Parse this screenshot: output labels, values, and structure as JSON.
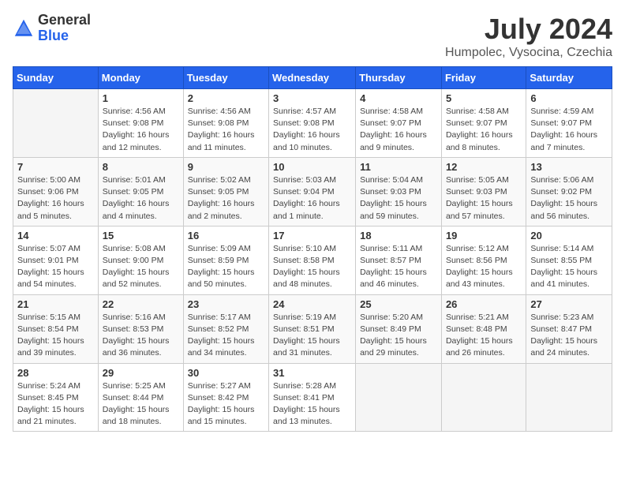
{
  "header": {
    "logo_general": "General",
    "logo_blue": "Blue",
    "month": "July 2024",
    "location": "Humpolec, Vysocina, Czechia"
  },
  "weekdays": [
    "Sunday",
    "Monday",
    "Tuesday",
    "Wednesday",
    "Thursday",
    "Friday",
    "Saturday"
  ],
  "weeks": [
    [
      {
        "day": "",
        "info": ""
      },
      {
        "day": "1",
        "info": "Sunrise: 4:56 AM\nSunset: 9:08 PM\nDaylight: 16 hours\nand 12 minutes."
      },
      {
        "day": "2",
        "info": "Sunrise: 4:56 AM\nSunset: 9:08 PM\nDaylight: 16 hours\nand 11 minutes."
      },
      {
        "day": "3",
        "info": "Sunrise: 4:57 AM\nSunset: 9:08 PM\nDaylight: 16 hours\nand 10 minutes."
      },
      {
        "day": "4",
        "info": "Sunrise: 4:58 AM\nSunset: 9:07 PM\nDaylight: 16 hours\nand 9 minutes."
      },
      {
        "day": "5",
        "info": "Sunrise: 4:58 AM\nSunset: 9:07 PM\nDaylight: 16 hours\nand 8 minutes."
      },
      {
        "day": "6",
        "info": "Sunrise: 4:59 AM\nSunset: 9:07 PM\nDaylight: 16 hours\nand 7 minutes."
      }
    ],
    [
      {
        "day": "7",
        "info": "Sunrise: 5:00 AM\nSunset: 9:06 PM\nDaylight: 16 hours\nand 5 minutes."
      },
      {
        "day": "8",
        "info": "Sunrise: 5:01 AM\nSunset: 9:05 PM\nDaylight: 16 hours\nand 4 minutes."
      },
      {
        "day": "9",
        "info": "Sunrise: 5:02 AM\nSunset: 9:05 PM\nDaylight: 16 hours\nand 2 minutes."
      },
      {
        "day": "10",
        "info": "Sunrise: 5:03 AM\nSunset: 9:04 PM\nDaylight: 16 hours\nand 1 minute."
      },
      {
        "day": "11",
        "info": "Sunrise: 5:04 AM\nSunset: 9:03 PM\nDaylight: 15 hours\nand 59 minutes."
      },
      {
        "day": "12",
        "info": "Sunrise: 5:05 AM\nSunset: 9:03 PM\nDaylight: 15 hours\nand 57 minutes."
      },
      {
        "day": "13",
        "info": "Sunrise: 5:06 AM\nSunset: 9:02 PM\nDaylight: 15 hours\nand 56 minutes."
      }
    ],
    [
      {
        "day": "14",
        "info": "Sunrise: 5:07 AM\nSunset: 9:01 PM\nDaylight: 15 hours\nand 54 minutes."
      },
      {
        "day": "15",
        "info": "Sunrise: 5:08 AM\nSunset: 9:00 PM\nDaylight: 15 hours\nand 52 minutes."
      },
      {
        "day": "16",
        "info": "Sunrise: 5:09 AM\nSunset: 8:59 PM\nDaylight: 15 hours\nand 50 minutes."
      },
      {
        "day": "17",
        "info": "Sunrise: 5:10 AM\nSunset: 8:58 PM\nDaylight: 15 hours\nand 48 minutes."
      },
      {
        "day": "18",
        "info": "Sunrise: 5:11 AM\nSunset: 8:57 PM\nDaylight: 15 hours\nand 46 minutes."
      },
      {
        "day": "19",
        "info": "Sunrise: 5:12 AM\nSunset: 8:56 PM\nDaylight: 15 hours\nand 43 minutes."
      },
      {
        "day": "20",
        "info": "Sunrise: 5:14 AM\nSunset: 8:55 PM\nDaylight: 15 hours\nand 41 minutes."
      }
    ],
    [
      {
        "day": "21",
        "info": "Sunrise: 5:15 AM\nSunset: 8:54 PM\nDaylight: 15 hours\nand 39 minutes."
      },
      {
        "day": "22",
        "info": "Sunrise: 5:16 AM\nSunset: 8:53 PM\nDaylight: 15 hours\nand 36 minutes."
      },
      {
        "day": "23",
        "info": "Sunrise: 5:17 AM\nSunset: 8:52 PM\nDaylight: 15 hours\nand 34 minutes."
      },
      {
        "day": "24",
        "info": "Sunrise: 5:19 AM\nSunset: 8:51 PM\nDaylight: 15 hours\nand 31 minutes."
      },
      {
        "day": "25",
        "info": "Sunrise: 5:20 AM\nSunset: 8:49 PM\nDaylight: 15 hours\nand 29 minutes."
      },
      {
        "day": "26",
        "info": "Sunrise: 5:21 AM\nSunset: 8:48 PM\nDaylight: 15 hours\nand 26 minutes."
      },
      {
        "day": "27",
        "info": "Sunrise: 5:23 AM\nSunset: 8:47 PM\nDaylight: 15 hours\nand 24 minutes."
      }
    ],
    [
      {
        "day": "28",
        "info": "Sunrise: 5:24 AM\nSunset: 8:45 PM\nDaylight: 15 hours\nand 21 minutes."
      },
      {
        "day": "29",
        "info": "Sunrise: 5:25 AM\nSunset: 8:44 PM\nDaylight: 15 hours\nand 18 minutes."
      },
      {
        "day": "30",
        "info": "Sunrise: 5:27 AM\nSunset: 8:42 PM\nDaylight: 15 hours\nand 15 minutes."
      },
      {
        "day": "31",
        "info": "Sunrise: 5:28 AM\nSunset: 8:41 PM\nDaylight: 15 hours\nand 13 minutes."
      },
      {
        "day": "",
        "info": ""
      },
      {
        "day": "",
        "info": ""
      },
      {
        "day": "",
        "info": ""
      }
    ]
  ]
}
